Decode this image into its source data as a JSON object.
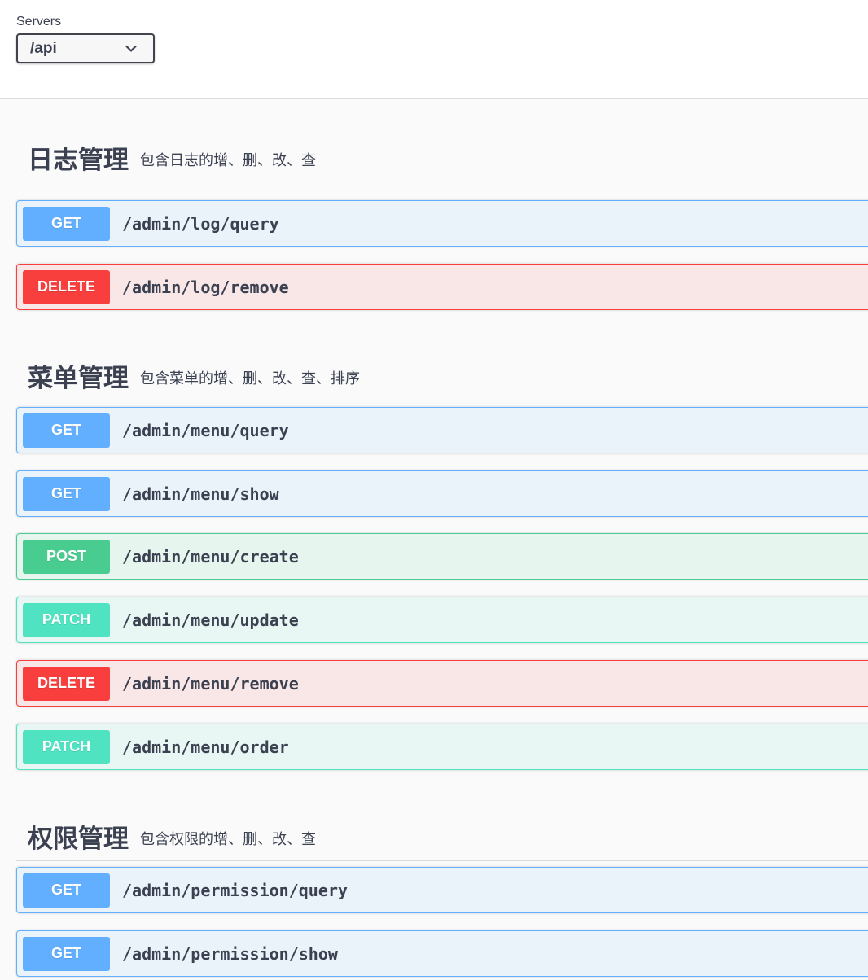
{
  "servers": {
    "label": "Servers",
    "selected": "/api"
  },
  "colors": {
    "get": "#61affe",
    "delete": "#f93e3e",
    "post": "#49cc90",
    "patch": "#50e3c2"
  },
  "tags": [
    {
      "title": "日志管理",
      "description": "包含日志的增、删、改、查",
      "operations": [
        {
          "method": "GET",
          "path": "/admin/log/query"
        },
        {
          "method": "DELETE",
          "path": "/admin/log/remove"
        }
      ]
    },
    {
      "title": "菜单管理",
      "description": "包含菜单的增、删、改、查、排序",
      "operations": [
        {
          "method": "GET",
          "path": "/admin/menu/query"
        },
        {
          "method": "GET",
          "path": "/admin/menu/show"
        },
        {
          "method": "POST",
          "path": "/admin/menu/create"
        },
        {
          "method": "PATCH",
          "path": "/admin/menu/update"
        },
        {
          "method": "DELETE",
          "path": "/admin/menu/remove"
        },
        {
          "method": "PATCH",
          "path": "/admin/menu/order"
        }
      ]
    },
    {
      "title": "权限管理",
      "description": "包含权限的增、删、改、查",
      "operations": [
        {
          "method": "GET",
          "path": "/admin/permission/query"
        },
        {
          "method": "GET",
          "path": "/admin/permission/show"
        }
      ]
    }
  ]
}
